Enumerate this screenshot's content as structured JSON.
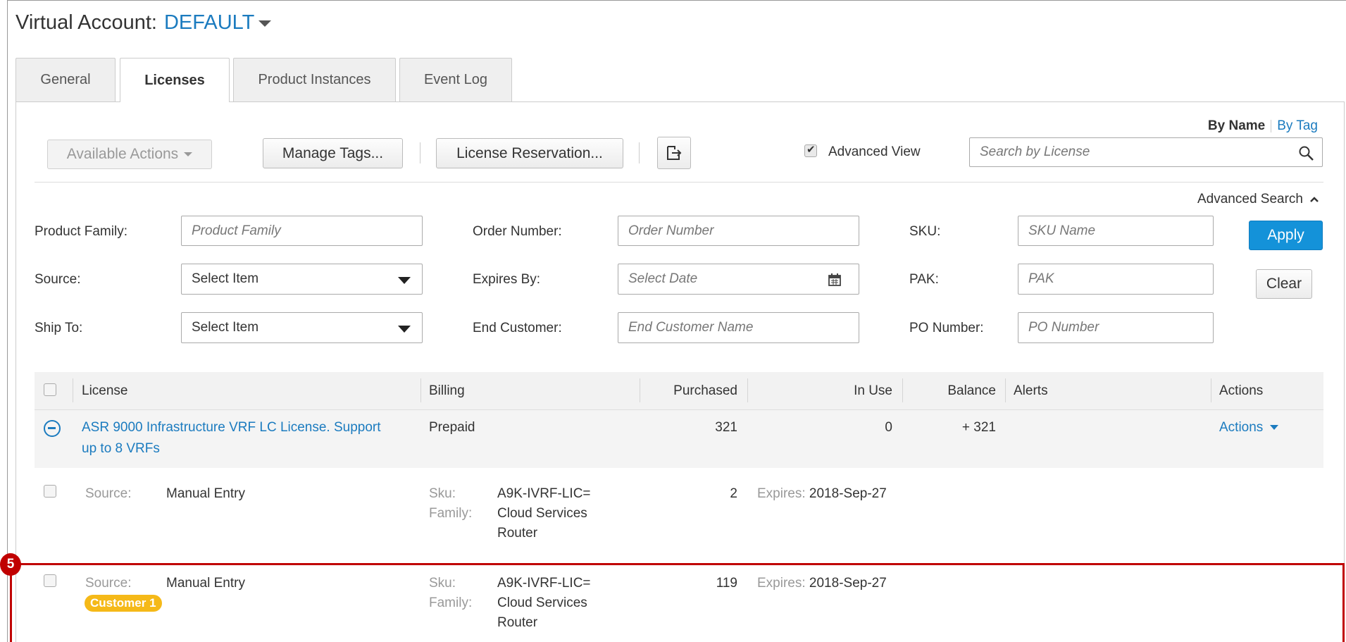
{
  "header": {
    "title": "Virtual Account:",
    "account": "DEFAULT"
  },
  "tabs": [
    "General",
    "Licenses",
    "Product Instances",
    "Event Log"
  ],
  "toolbar": {
    "available_actions": "Available Actions",
    "manage_tags": "Manage Tags...",
    "license_reservation": "License Reservation...",
    "advanced_view_label": "Advanced View",
    "advanced_view_checked": true,
    "search_placeholder": "Search by License",
    "by_name": "By Name",
    "by_tag": "By Tag"
  },
  "advanced_search": {
    "title": "Advanced Search",
    "product_family": {
      "label": "Product Family:",
      "placeholder": "Product Family"
    },
    "source": {
      "label": "Source:",
      "value": "Select Item"
    },
    "ship_to": {
      "label": "Ship To:",
      "value": "Select Item"
    },
    "order_number": {
      "label": "Order Number:",
      "placeholder": "Order Number"
    },
    "expires_by": {
      "label": "Expires By:",
      "placeholder": "Select Date"
    },
    "end_customer": {
      "label": "End Customer:",
      "placeholder": "End Customer Name"
    },
    "sku": {
      "label": "SKU:",
      "placeholder": "SKU Name"
    },
    "pak": {
      "label": "PAK:",
      "placeholder": "PAK"
    },
    "po_number": {
      "label": "PO Number:",
      "placeholder": "PO Number"
    },
    "apply": "Apply",
    "clear": "Clear"
  },
  "table": {
    "columns": {
      "license": "License",
      "billing": "Billing",
      "purchased": "Purchased",
      "in_use": "In Use",
      "balance": "Balance",
      "alerts": "Alerts",
      "actions": "Actions"
    },
    "license_row": {
      "name_line1": "ASR 9000 Infrastructure VRF LC License. Support",
      "name_line2": "up to 8 VRFs",
      "billing": "Prepaid",
      "purchased": "321",
      "in_use": "0",
      "balance": "+ 321",
      "actions": "Actions"
    },
    "detail_rows": [
      {
        "source_label": "Source:",
        "source": "Manual Entry",
        "sku_label": "Sku:",
        "sku": "A9K-IVRF-LIC=",
        "family_label": "Family:",
        "family_line1": "Cloud Services",
        "family_line2": "Router",
        "quantity": "2",
        "expires_label": "Expires:",
        "expires": "2018-Sep-27"
      },
      {
        "source_label": "Source:",
        "source": "Manual Entry",
        "tag": "Customer 1",
        "sku_label": "Sku:",
        "sku": "A9K-IVRF-LIC=",
        "family_label": "Family:",
        "family_line1": "Cloud Services",
        "family_line2": "Router",
        "quantity": "119",
        "expires_label": "Expires:",
        "expires": "2018-Sep-27"
      }
    ]
  },
  "annotation": {
    "step": "5",
    "color": "#c00000"
  },
  "colors": {
    "link": "#1b7bbf",
    "primary_button": "#1492d9",
    "tag_badge": "#f5b918"
  }
}
